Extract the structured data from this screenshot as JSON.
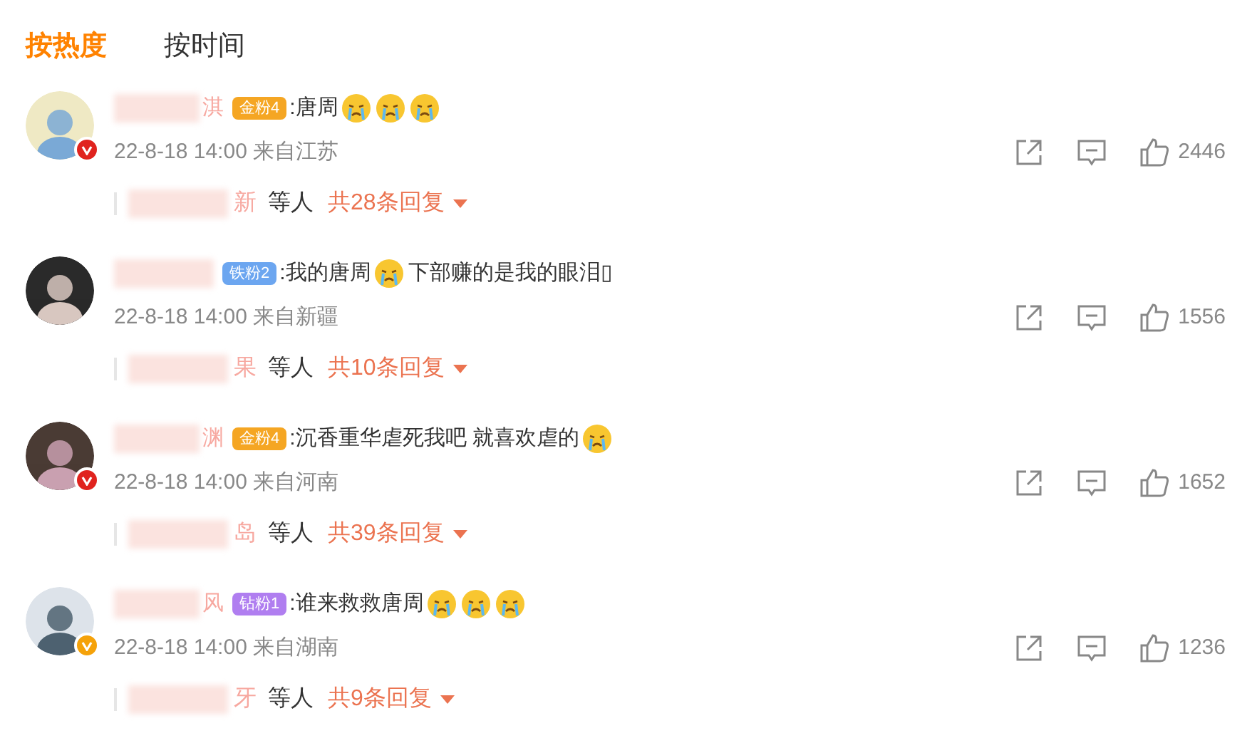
{
  "tabs": [
    {
      "label": "按热度",
      "selected": true
    },
    {
      "label": "按时间",
      "selected": false
    }
  ],
  "comments": [
    {
      "name_tail": "淇",
      "verified_badge": {
        "color": "#e0231e"
      },
      "badge": {
        "label": "金粉4",
        "color": "#f5a623"
      },
      "content": [
        {
          "kind": "text",
          "text": ":唐周"
        },
        {
          "kind": "emoji"
        },
        {
          "kind": "emoji"
        },
        {
          "kind": "emoji"
        }
      ],
      "time": "22-8-18 14:00 来自江苏",
      "likes": "2446",
      "reply_name_tail": "新",
      "reply_suffix": "等人",
      "reply_count": "共28条回复"
    },
    {
      "badge": {
        "label": "铁粉2",
        "color": "#6ca6f0"
      },
      "content": [
        {
          "kind": "text",
          "text": ":我的唐周"
        },
        {
          "kind": "emoji"
        },
        {
          "kind": "text",
          "text": "下部赚的是我的眼泪▯"
        }
      ],
      "time": "22-8-18 14:00 来自新疆",
      "likes": "1556",
      "reply_name_tail": "果",
      "reply_suffix": "等人",
      "reply_count": "共10条回复"
    },
    {
      "name_tail": "渊",
      "verified_badge": {
        "color": "#e0231e"
      },
      "badge": {
        "label": "金粉4",
        "color": "#f5a623"
      },
      "content": [
        {
          "kind": "text",
          "text": ":沉香重华虐死我吧 就喜欢虐的"
        },
        {
          "kind": "emoji"
        }
      ],
      "time": "22-8-18 14:00 来自河南",
      "likes": "1652",
      "reply_name_tail": "岛",
      "reply_suffix": "等人",
      "reply_count": "共39条回复"
    },
    {
      "name_tail": "风",
      "verified_badge": {
        "color": "#f5a20a"
      },
      "badge": {
        "label": "钻粉1",
        "color": "#b07ef0"
      },
      "content": [
        {
          "kind": "text",
          "text": ":谁来救救唐周"
        },
        {
          "kind": "emoji"
        },
        {
          "kind": "emoji"
        },
        {
          "kind": "emoji"
        }
      ],
      "time": "22-8-18 14:00 来自湖南",
      "likes": "1236",
      "reply_name_tail": "牙",
      "reply_suffix": "等人",
      "reply_count": "共9条回复"
    }
  ]
}
